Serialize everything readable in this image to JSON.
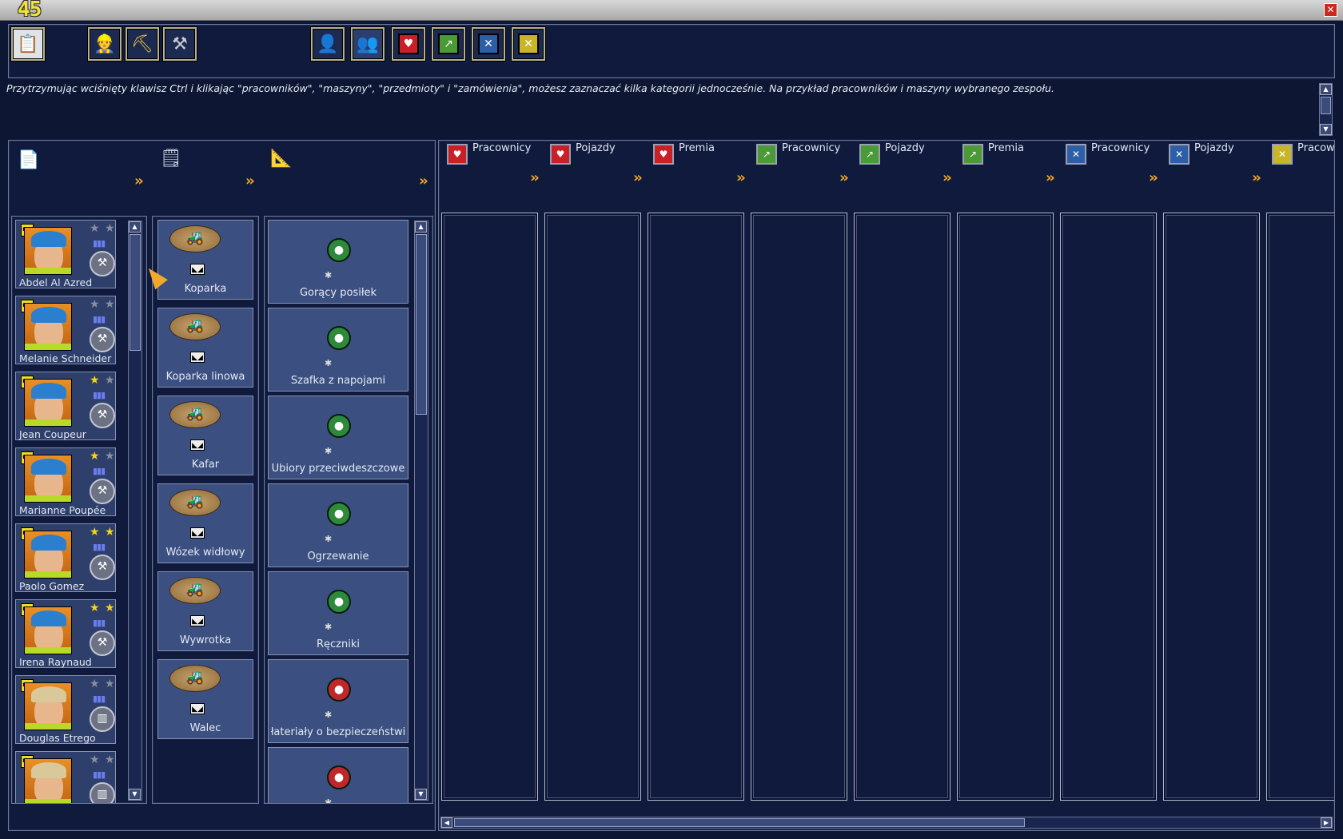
{
  "round_number": "45",
  "hint": "Przytrzymując wciśnięty klawisz Ctrl i klikając \"pracowników\", \"maszyny\", \"przedmioty\" i \"zamówienia\", możesz zaznaczać kilka kategorii jednocześnie. Na przykład pracowników i maszyny wybranego zespołu.",
  "colors": {
    "background": "#0d1633",
    "card": "#3b5080",
    "accent_orange": "#f7a823",
    "team_red": "#c91f26",
    "team_green": "#4a9a38",
    "team_blue": "#2c5fa8",
    "team_yellow": "#c9b52a"
  },
  "toolbar": {
    "buttons": [
      {
        "icon": "clipboard-icon"
      },
      {
        "icon": "worker-icon"
      },
      {
        "icon": "excavator-icon"
      },
      {
        "icon": "shovel-icon"
      },
      {
        "icon": "manager-portrait-icon"
      },
      {
        "icon": "team-icon"
      },
      {
        "icon": "red-team-icon"
      },
      {
        "icon": "green-team-icon"
      },
      {
        "icon": "blue-team-icon"
      },
      {
        "icon": "yellow-team-icon"
      }
    ]
  },
  "workers": [
    {
      "name": "Abdel Al Azred",
      "stars": 0
    },
    {
      "name": "Melanie Schneider",
      "stars": 0
    },
    {
      "name": "Jean Coupeur",
      "stars": 1
    },
    {
      "name": "Marianne Poupée",
      "stars": 1
    },
    {
      "name": "Paolo Gomez",
      "stars": 2
    },
    {
      "name": "Irena Raynaud",
      "stars": 2
    },
    {
      "name": "Douglas Etrego",
      "stars": 0
    },
    {
      "name": "",
      "stars": 0
    }
  ],
  "machines": [
    {
      "name": "Koparka",
      "icon": "excavator-icon"
    },
    {
      "name": "Koparka linowa",
      "icon": "cable-excavator-icon"
    },
    {
      "name": "Kafar",
      "icon": "pile-driver-icon"
    },
    {
      "name": "Wózek widłowy",
      "icon": "forklift-icon"
    },
    {
      "name": "Wywrotka",
      "icon": "dump-truck-icon"
    },
    {
      "name": "Walec",
      "icon": "road-roller-icon"
    }
  ],
  "items": [
    {
      "name": "Gorący posiłek",
      "icon": "meal-icon",
      "color": "#2c8a3a"
    },
    {
      "name": "Szafka z napojami",
      "icon": "drinks-icon",
      "color": "#2c8a3a"
    },
    {
      "name": "Ubiory przeciwdeszczowe",
      "icon": "rain-gear-icon",
      "color": "#2c8a3a"
    },
    {
      "name": "Ogrzewanie",
      "icon": "heating-icon",
      "color": "#2c8a3a"
    },
    {
      "name": "Ręczniki",
      "icon": "towel-icon",
      "color": "#2c8a3a"
    },
    {
      "name": "łateriały o bezpieczeństwi",
      "icon": "safety-book-icon",
      "color": "#c0262a"
    },
    {
      "name": "",
      "icon": "first-aid-icon",
      "color": "#c0262a"
    }
  ],
  "team_columns": [
    {
      "label": "Pracownicy",
      "team": "red"
    },
    {
      "label": "Pojazdy",
      "team": "red"
    },
    {
      "label": "Premia",
      "team": "red"
    },
    {
      "label": "Pracownicy",
      "team": "green"
    },
    {
      "label": "Pojazdy",
      "team": "green"
    },
    {
      "label": "Premia",
      "team": "green"
    },
    {
      "label": "Pracownicy",
      "team": "blue"
    },
    {
      "label": "Pojazdy",
      "team": "blue"
    },
    {
      "label": "Pracow",
      "team": "yellow"
    }
  ]
}
